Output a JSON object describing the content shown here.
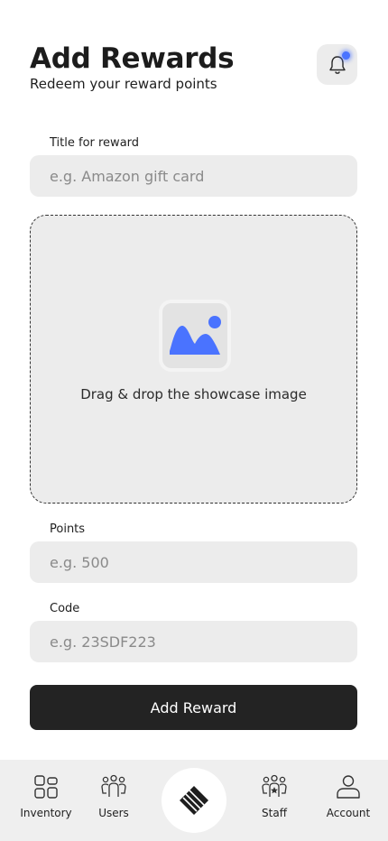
{
  "header": {
    "title": "Add Rewards",
    "subtitle": "Redeem your reward points",
    "notification_icon": "bell-icon",
    "notification_dot_color": "#4a73ff"
  },
  "form": {
    "title_field": {
      "label": "Title for reward",
      "placeholder": "e.g. Amazon gift card",
      "value": ""
    },
    "image_dropzone": {
      "text": "Drag & drop the showcase image",
      "icon": "image-icon",
      "icon_color": "#4a73ff"
    },
    "points_field": {
      "label": "Points",
      "placeholder": "e.g. 500",
      "value": ""
    },
    "code_field": {
      "label": "Code",
      "placeholder": "e.g. 23SDF223",
      "value": ""
    },
    "submit_label": "Add Reward"
  },
  "tabbar": {
    "items": [
      {
        "label": "Inventory",
        "icon": "grid-icon"
      },
      {
        "label": "Users",
        "icon": "users-icon"
      },
      {
        "label": "",
        "icon": "logo-icon"
      },
      {
        "label": "Staff",
        "icon": "staff-badge-icon"
      },
      {
        "label": "Account",
        "icon": "user-icon"
      }
    ]
  }
}
